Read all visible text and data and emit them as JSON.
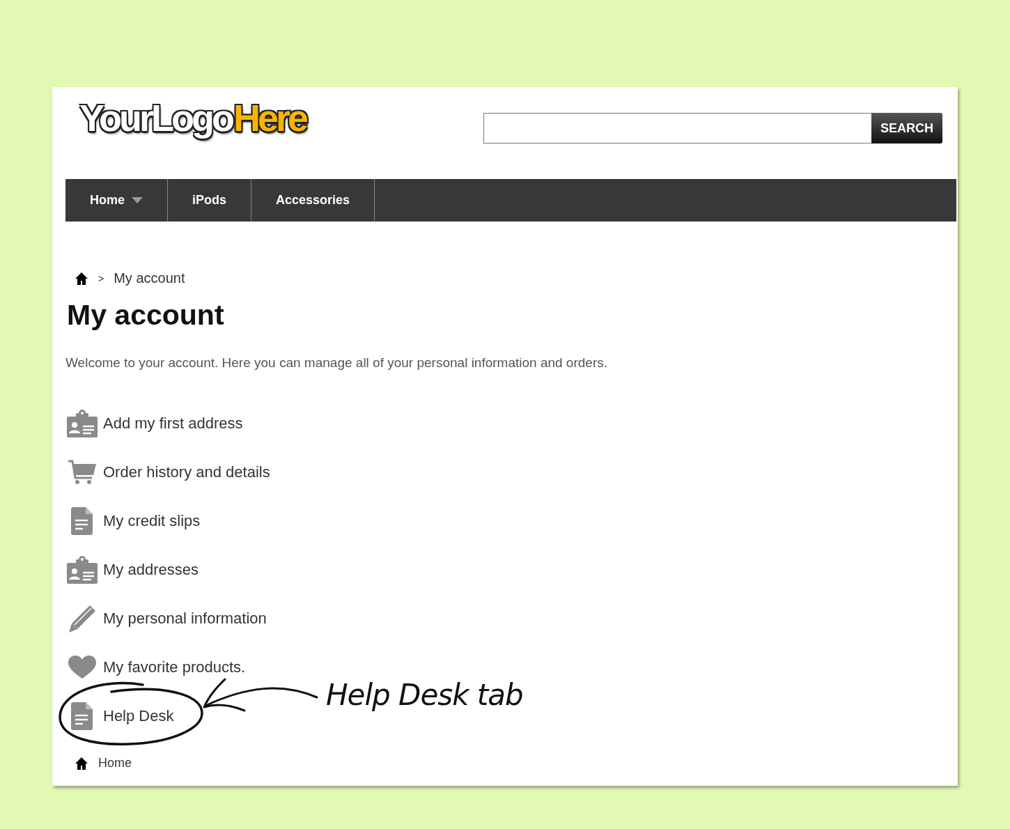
{
  "logo": [
    {
      "text": "YourLogo",
      "color": "#ffffff"
    },
    {
      "text": "Here",
      "color": "#f7b500"
    }
  ],
  "search": {
    "button": "SEARCH"
  },
  "nav": [
    {
      "label": "Home",
      "has_dropdown": true
    },
    {
      "label": "iPods",
      "has_dropdown": false
    },
    {
      "label": "Accessories",
      "has_dropdown": false
    }
  ],
  "breadcrumb": {
    "separator": ">",
    "current": "My account"
  },
  "title": "My account",
  "intro": "Welcome to your account. Here you can manage all of your personal information and orders.",
  "links": [
    {
      "label": "Add my first address",
      "kind": "address"
    },
    {
      "label": "Order history and details",
      "kind": "cart"
    },
    {
      "label": "My credit slips",
      "kind": "document"
    },
    {
      "label": "My addresses",
      "kind": "address"
    },
    {
      "label": "My personal information",
      "kind": "pencil"
    },
    {
      "label": "My favorite products.",
      "kind": "heart"
    },
    {
      "label": "Help Desk",
      "kind": "document"
    }
  ],
  "footer_link": "Home",
  "annotation": {
    "text": "Help Desk tab"
  }
}
